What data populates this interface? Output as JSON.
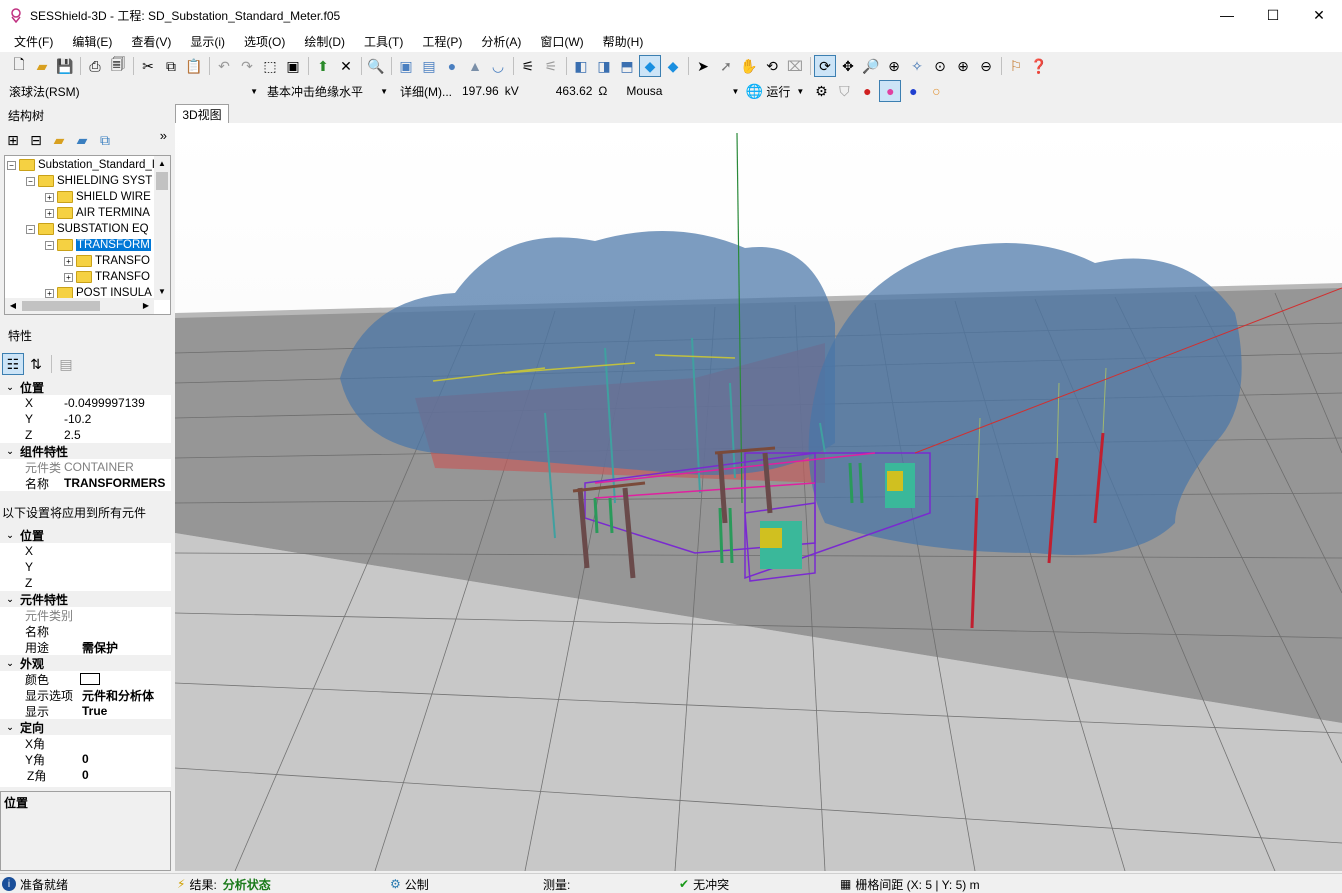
{
  "window": {
    "title": "SESShield-3D - 工程: SD_Substation_Standard_Meter.f05",
    "minimize": "—",
    "maximize": "☐",
    "close": "✕"
  },
  "menu": [
    "文件(F)",
    "编辑(E)",
    "查看(V)",
    "显示(i)",
    "选项(O)",
    "绘制(D)",
    "工具(T)",
    "工程(P)",
    "分析(A)",
    "窗口(W)",
    "帮助(H)"
  ],
  "toolbar2": {
    "method": "滚球法(RSM)",
    "insulation": "基本冲击绝缘水平",
    "detail": "详细(M)...",
    "voltage_value": "197.96",
    "voltage_unit": "kV",
    "resistance_value": "463.62",
    "resistance_unit": "Ω",
    "model": "Mousa",
    "run": "运行"
  },
  "structure_tree": {
    "title": "结构树",
    "more": "»",
    "items": [
      {
        "label": "Substation_Standard_I",
        "level": 0,
        "expander": "−"
      },
      {
        "label": "SHIELDING SYST",
        "level": 1,
        "expander": "−"
      },
      {
        "label": "SHIELD WIRE",
        "level": 2,
        "expander": "+"
      },
      {
        "label": "AIR TERMINA",
        "level": 2,
        "expander": "+"
      },
      {
        "label": "SUBSTATION EQ",
        "level": 1,
        "expander": "−"
      },
      {
        "label": "TRANSFORM",
        "level": 2,
        "expander": "−",
        "selected": true
      },
      {
        "label": "TRANSFO",
        "level": 3,
        "expander": "+"
      },
      {
        "label": "TRANSFO",
        "level": 3,
        "expander": "+"
      },
      {
        "label": "POST INSULA",
        "level": 2,
        "expander": "+"
      }
    ]
  },
  "properties": {
    "title": "特性",
    "position_cat": "位置",
    "x_key": "X",
    "x_val": "-0.0499997139",
    "y_key": "Y",
    "y_val": "-10.2",
    "z_key": "Z",
    "z_val": "2.5",
    "group_cat": "组件特性",
    "type_key": "元件类",
    "type_val": "CONTAINER",
    "name_key": "名称",
    "name_val": "TRANSFORMERS"
  },
  "bulk": {
    "note": "以下设置将应用到所有元件",
    "position_cat": "位置",
    "x_key": "X",
    "y_key": "Y",
    "z_key": "Z",
    "element_cat": "元件特性",
    "type_key": "元件类别",
    "name_key": "名称",
    "use_key": "用途",
    "use_val": "需保护",
    "appearance_cat": "外观",
    "color_key": "颜色",
    "display_opt_key": "显示选项",
    "display_opt_val": "元件和分析体",
    "display_key": "显示",
    "display_val": "True",
    "orient_cat": "定向",
    "xang_key": "X角",
    "xang_val": "",
    "yang_key": "Y角",
    "yang_val": "0",
    "zang_key": "Z角",
    "zang_val": "0"
  },
  "description": {
    "title": "位置"
  },
  "view_tab": "3D视图",
  "status": {
    "ready": "准备就绪",
    "result_label": "结果:",
    "result_val": "分析状态",
    "units": "公制",
    "measure": "测量:",
    "conflict": "无冲突",
    "grid": "栅格间距 (X: 5 | Y: 5) m"
  },
  "colors": {
    "selection": "#0078d7",
    "sphere": "#4a76a8",
    "floor": "#9a9a9a",
    "zone": "#c05c5c",
    "status_green": "#1a7a1a"
  }
}
